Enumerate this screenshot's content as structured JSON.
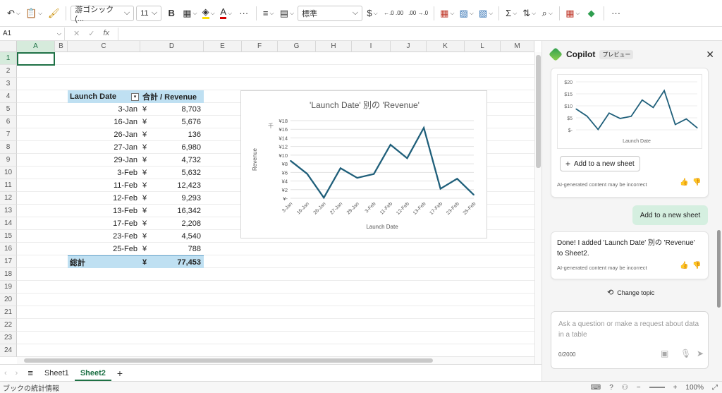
{
  "ribbon": {
    "font_name": "游ゴシック (...",
    "font_size": "11",
    "bold": "B",
    "font_color_letter": "A",
    "more": "···",
    "number_format": "標準",
    "currency": "$",
    "inc_decimal": "←.0 .00",
    "dec_decimal": ".00 →.0",
    "sum": "Σ",
    "overflow": "···",
    "fill_color": "#ffe000",
    "font_color": "#d40000"
  },
  "formula_bar": {
    "name_box": "A1",
    "fx": "fx"
  },
  "grid": {
    "columns": [
      {
        "label": "A",
        "w": 54
      },
      {
        "label": "B",
        "w": 18
      },
      {
        "label": "C",
        "w": 103
      },
      {
        "label": "D",
        "w": 90
      },
      {
        "label": "E",
        "w": 54
      },
      {
        "label": "F",
        "w": 51
      },
      {
        "label": "G",
        "w": 54
      },
      {
        "label": "H",
        "w": 51
      },
      {
        "label": "I",
        "w": 55
      },
      {
        "label": "J",
        "w": 51
      },
      {
        "label": "K",
        "w": 54
      },
      {
        "label": "L",
        "w": 51
      },
      {
        "label": "M",
        "w": 48
      }
    ],
    "rows": [
      "1",
      "2",
      "3",
      "4",
      "5",
      "6",
      "7",
      "8",
      "9",
      "10",
      "11",
      "12",
      "13",
      "14",
      "15",
      "16",
      "17",
      "18",
      "19",
      "20",
      "21",
      "22",
      "23",
      "24"
    ]
  },
  "pivot": {
    "header_date": "Launch Date",
    "header_sum": "合計 / Revenue",
    "rows": [
      {
        "date": "3-Jan",
        "yen": "¥",
        "value": "8,703"
      },
      {
        "date": "16-Jan",
        "yen": "¥",
        "value": "5,676"
      },
      {
        "date": "26-Jan",
        "yen": "¥",
        "value": "136"
      },
      {
        "date": "27-Jan",
        "yen": "¥",
        "value": "6,980"
      },
      {
        "date": "29-Jan",
        "yen": "¥",
        "value": "4,732"
      },
      {
        "date": "3-Feb",
        "yen": "¥",
        "value": "5,632"
      },
      {
        "date": "11-Feb",
        "yen": "¥",
        "value": "12,423"
      },
      {
        "date": "12-Feb",
        "yen": "¥",
        "value": "9,293"
      },
      {
        "date": "13-Feb",
        "yen": "¥",
        "value": "16,342"
      },
      {
        "date": "17-Feb",
        "yen": "¥",
        "value": "2,208"
      },
      {
        "date": "23-Feb",
        "yen": "¥",
        "value": "4,540"
      },
      {
        "date": "25-Feb",
        "yen": "¥",
        "value": "788"
      }
    ],
    "total_label": "総計",
    "total_yen": "¥",
    "total_value": "77,453"
  },
  "chart_data": [
    {
      "type": "line",
      "title": "'Launch Date' 別の 'Revenue'",
      "xlabel": "Launch Date",
      "ylabel": "Revenue",
      "unit_label": "千",
      "categories": [
        "3-Jan",
        "16-Jan",
        "26-Jan",
        "27-Jan",
        "29-Jan",
        "3-Feb",
        "11-Feb",
        "12-Feb",
        "13-Feb",
        "17-Feb",
        "23-Feb",
        "25-Feb"
      ],
      "values": [
        8.703,
        5.676,
        0.136,
        6.98,
        4.732,
        5.632,
        12.423,
        9.293,
        16.342,
        2.208,
        4.54,
        0.788
      ],
      "yticks": [
        "¥-",
        "¥2",
        "¥4",
        "¥6",
        "¥8",
        "¥10",
        "¥12",
        "¥14",
        "¥16",
        "¥18"
      ],
      "ylim": [
        0,
        18
      ],
      "grid": true,
      "color": "#1f5f7a"
    },
    {
      "type": "line",
      "xlabel": "Launch Date",
      "values": [
        8.703,
        5.676,
        0.136,
        6.98,
        4.732,
        5.632,
        12.423,
        9.293,
        16.342,
        2.208,
        4.54,
        0.788
      ],
      "yticks": [
        "$-",
        "$5",
        "$10",
        "$15",
        "$20"
      ],
      "ylim": [
        0,
        20
      ],
      "grid": true,
      "color": "#1f5f7a"
    }
  ],
  "sheets": {
    "tabs": [
      "Sheet1",
      "Sheet2"
    ],
    "active": "Sheet2",
    "add": "+"
  },
  "status": {
    "left": "ブックの統計情報",
    "zoom": "100%"
  },
  "copilot": {
    "title": "Copilot",
    "badge": "プレビュー",
    "add_sheet_btn": "Add to a new sheet",
    "ai_note": "AI-generated content may be incorrect",
    "user_msg": "Add to a new sheet",
    "reply": "Done! I added 'Launch Date' 別の 'Revenue' to Sheet2.",
    "change_topic": "Change topic",
    "input_placeholder": "Ask a question or make a request about data in a table",
    "char_count": "0/2000"
  }
}
